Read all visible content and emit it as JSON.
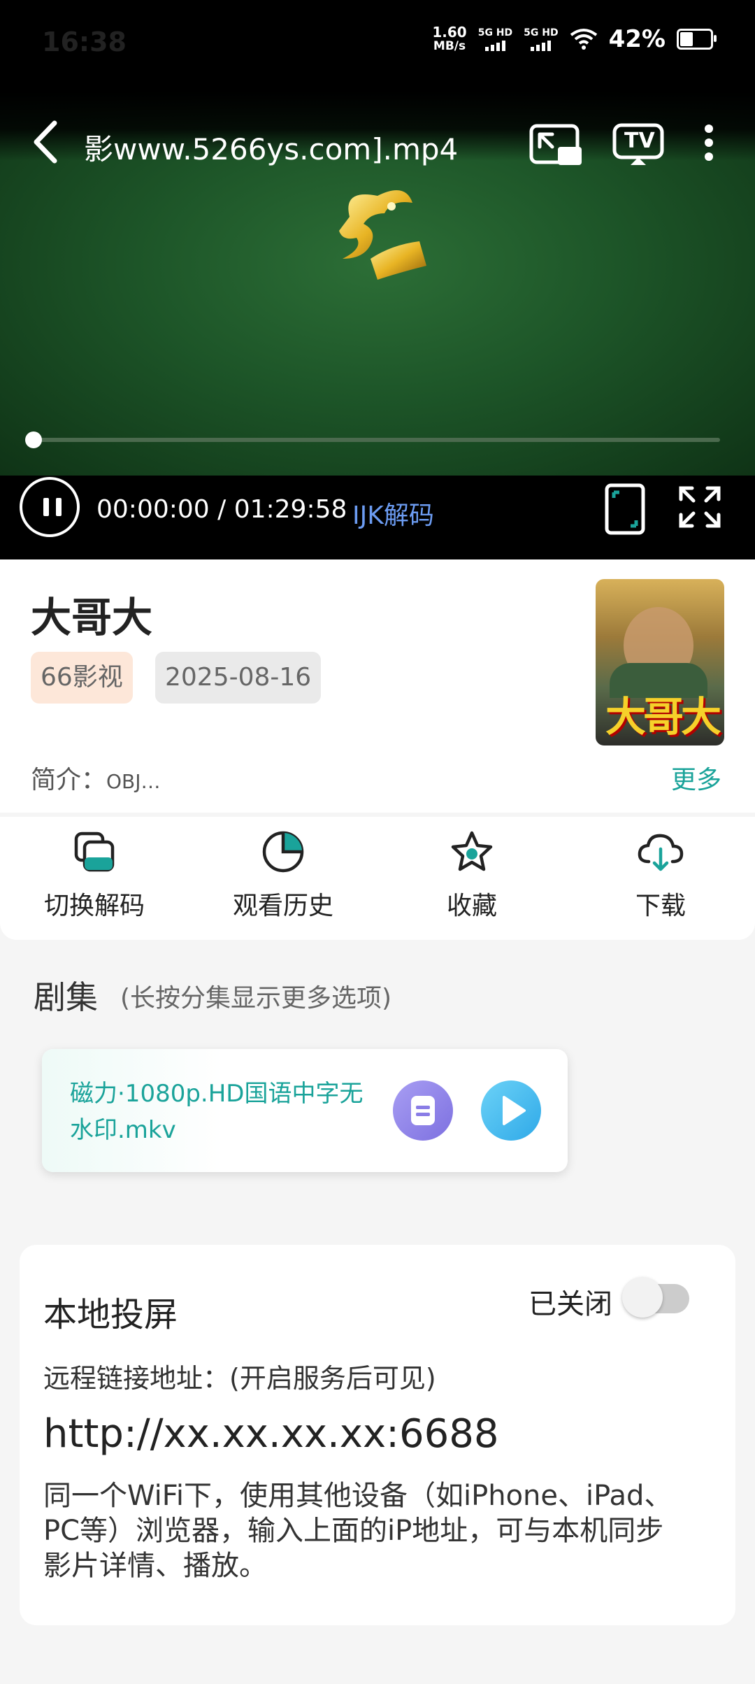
{
  "status": {
    "time": "16:38",
    "net_speed_value": "1.60",
    "net_speed_unit": "MB/s",
    "sim1": "5G HD",
    "sim2": "5G HD",
    "battery": "42%",
    "battery_level": 0.42
  },
  "player": {
    "title": "影www.5266ys.com].mp4",
    "time_current": "00:00:00",
    "time_total": "01:29:58",
    "time_display": "00:00:00 / 01:29:58",
    "decoder": "IJK解码",
    "progress": 0.0,
    "cast_label": "TV"
  },
  "movie": {
    "title": "大哥大",
    "source_tag": "66影视",
    "date_tag": "2025-08-16",
    "intro_label": "简介：",
    "intro_text": "OBJ…",
    "more_label": "更多",
    "poster_text": "大哥大"
  },
  "actions": [
    {
      "label": "切换解码",
      "icon": "switch-decoder-icon"
    },
    {
      "label": "观看历史",
      "icon": "history-pie-icon"
    },
    {
      "label": "收藏",
      "icon": "star-icon"
    },
    {
      "label": "下载",
      "icon": "cloud-download-icon"
    }
  ],
  "episodes": {
    "title": "剧集",
    "hint": "(长按分集显示更多选项)",
    "items": [
      {
        "name": "磁力·1080p.HD国语中字无水印.mkv"
      }
    ]
  },
  "cast": {
    "title": "本地投屏",
    "state_label": "已关闭",
    "enabled": false,
    "subtitle": "远程链接地址：(开启服务后可见)",
    "url": "http://xx.xx.xx.xx:6688",
    "description": "同一个WiFi下，使用其他设备（如iPhone、iPad、PC等）浏览器，输入上面的iP地址，可与本机同步影片详情、播放。"
  },
  "colors": {
    "accent": "#1aa39a",
    "decoder_blue": "#6c9cf2",
    "tag_orange_bg": "#fde7d9"
  }
}
